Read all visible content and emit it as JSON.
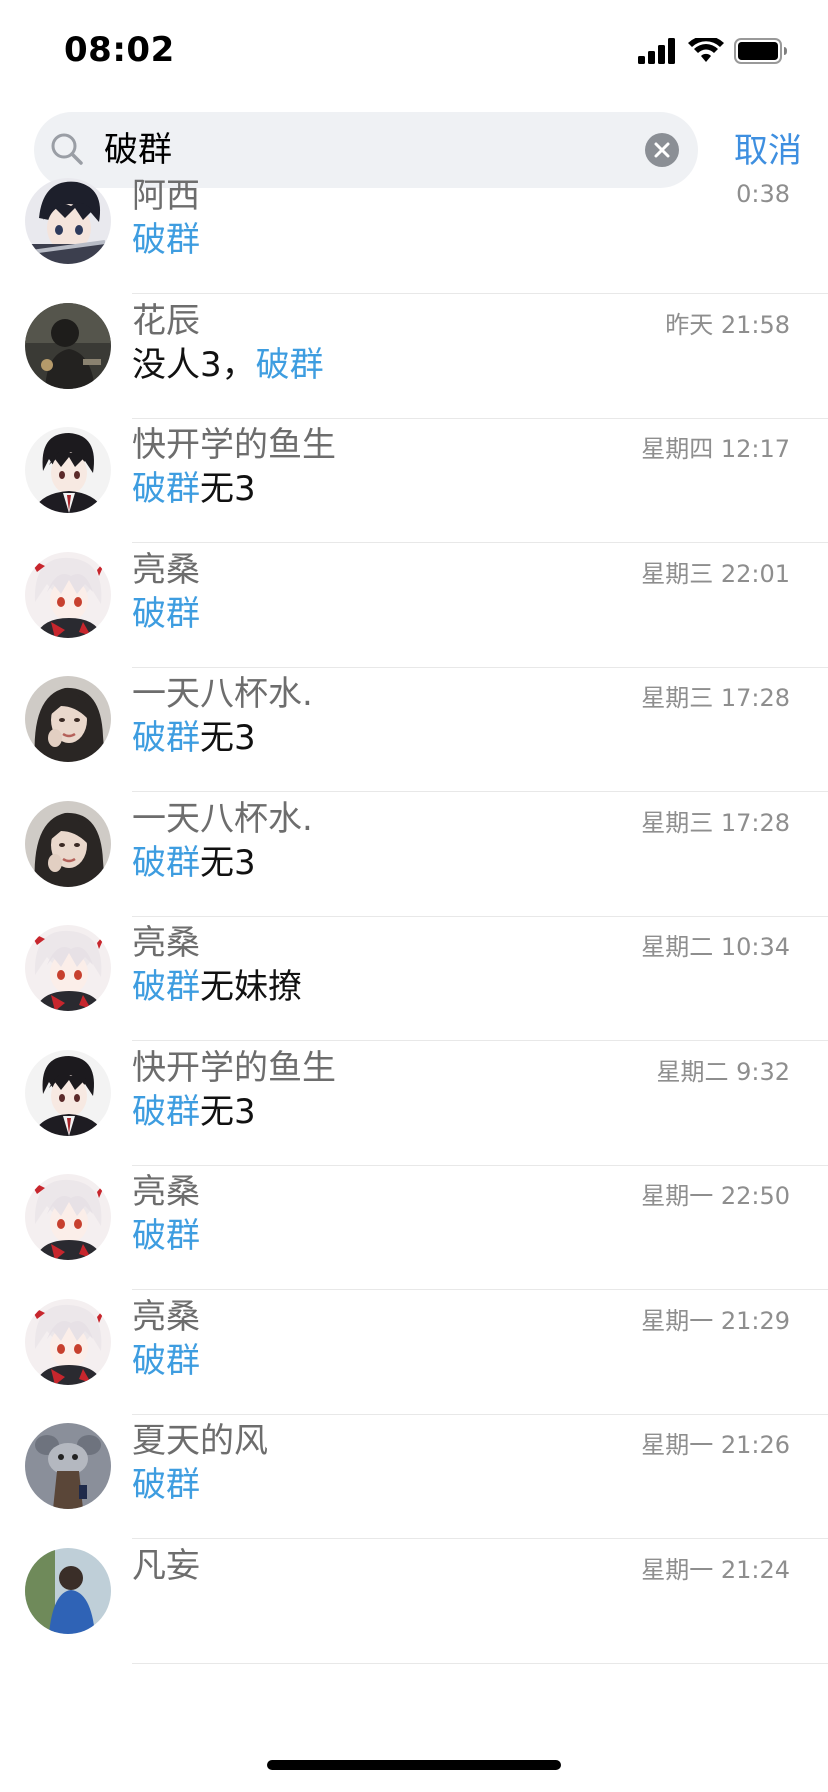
{
  "status_bar": {
    "time": "08:02",
    "icons": [
      "cellular-signal-icon",
      "wifi-icon",
      "battery-icon"
    ]
  },
  "search": {
    "query": "破群",
    "cancel_label": "取消",
    "icons": [
      "search-icon",
      "clear-icon"
    ]
  },
  "colors": {
    "highlight": "#3e9de0",
    "cancel": "#3e8fe0",
    "search_bg": "#eff1f4"
  },
  "results": [
    {
      "name": "阿西",
      "time": "0:38",
      "preview_pre": "",
      "preview_hl": "破群",
      "preview_post": "",
      "avatar": "anime-boy-sword"
    },
    {
      "name": "花辰",
      "time": "昨天 21:58",
      "preview_pre": "没人3，",
      "preview_hl": "破群",
      "preview_post": "",
      "avatar": "dark-photo-person"
    },
    {
      "name": "快开学的鱼生",
      "time": "星期四 12:17",
      "preview_pre": "",
      "preview_hl": "破群",
      "preview_post": "无3",
      "avatar": "anime-boy-dark-hair"
    },
    {
      "name": "亮桑",
      "time": "星期三 22:01",
      "preview_pre": "",
      "preview_hl": "破群",
      "preview_post": "",
      "avatar": "anime-white-hair"
    },
    {
      "name": "一天八杯水.",
      "time": "星期三 17:28",
      "preview_pre": "",
      "preview_hl": "破群",
      "preview_post": "无3",
      "avatar": "photo-girl"
    },
    {
      "name": "一天八杯水.",
      "time": "星期三 17:28",
      "preview_pre": "",
      "preview_hl": "破群",
      "preview_post": "无3",
      "avatar": "photo-girl"
    },
    {
      "name": "亮桑",
      "time": "星期二 10:34",
      "preview_pre": "",
      "preview_hl": "破群",
      "preview_post": "无妹撩",
      "avatar": "anime-white-hair"
    },
    {
      "name": "快开学的鱼生",
      "time": "星期二 9:32",
      "preview_pre": "",
      "preview_hl": "破群",
      "preview_post": "无3",
      "avatar": "anime-boy-dark-hair"
    },
    {
      "name": "亮桑",
      "time": "星期一 22:50",
      "preview_pre": "",
      "preview_hl": "破群",
      "preview_post": "",
      "avatar": "anime-white-hair"
    },
    {
      "name": "亮桑",
      "time": "星期一 21:29",
      "preview_pre": "",
      "preview_hl": "破群",
      "preview_post": "",
      "avatar": "anime-white-hair"
    },
    {
      "name": "夏天的风",
      "time": "星期一 21:26",
      "preview_pre": "",
      "preview_hl": "破群",
      "preview_post": "",
      "avatar": "cartoon-mouse"
    },
    {
      "name": "凡妄",
      "time": "星期一 21:24",
      "preview_pre": "",
      "preview_hl": "",
      "preview_post": "",
      "avatar": "photo-outdoor"
    }
  ]
}
